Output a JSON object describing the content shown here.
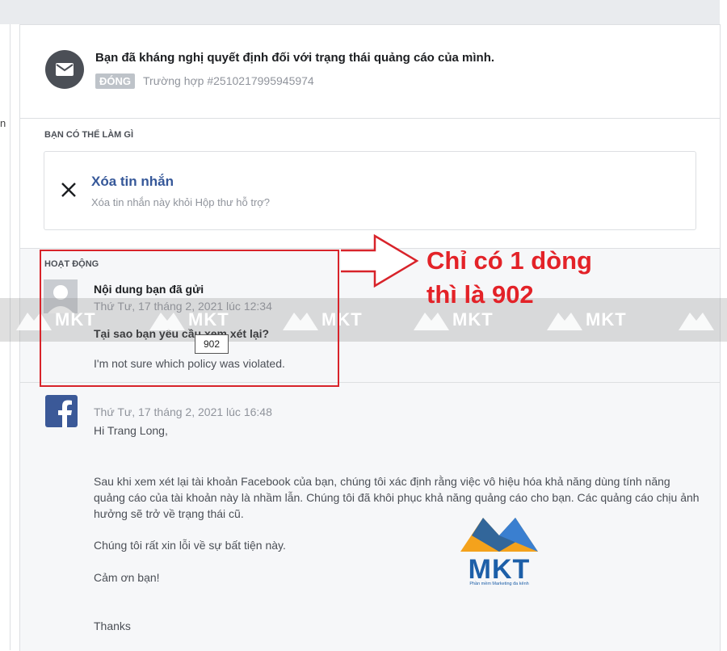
{
  "left_cut_text": "n",
  "header": {
    "title": "Bạn đã kháng nghị quyết định đối với trạng thái quảng cáo của mình.",
    "status_badge": "ĐÓNG",
    "case_text": "Trường hợp #2510217995945974"
  },
  "actions_section": {
    "label": "BẠN CÓ THỂ LÀM GÌ",
    "delete_title": "Xóa tin nhắn",
    "delete_desc": "Xóa tin nhắn này khỏi Hộp thư hỗ trợ?"
  },
  "activity": {
    "label": "HOẠT ĐỘNG",
    "message1": {
      "name": "Nội dung bạn đã gửi",
      "time": "Thứ Tư, 17 tháng 2, 2021 lúc 12:34",
      "question": "Tại sao bạn yêu cầu xem xét lại?",
      "answer": "I'm not sure which policy was violated."
    },
    "message2": {
      "time": "Thứ Tư, 17 tháng 2, 2021 lúc 16:48",
      "greeting": "Hi Trang Long,",
      "paragraph1": "Sau khi xem xét lại tài khoản Facebook của bạn, chúng tôi xác định rằng việc vô hiệu hóa khả năng dùng tính năng quảng cáo của tài khoản này là nhầm lẫn. Chúng tôi đã khôi phục khả năng quảng cáo cho bạn. Các quảng cáo chịu ảnh hưởng sẽ trở về trạng thái cũ.",
      "paragraph2": "Chúng tôi rất xin lỗi về sự bất tiện này.",
      "paragraph3": "Cảm ơn bạn!",
      "paragraph4": "Thanks"
    }
  },
  "overlay": {
    "tooltip": "902",
    "annotation_line1": "Chỉ có 1 dòng",
    "annotation_line2": "thì là 902",
    "watermark_text": "MKT",
    "logo_text": "MKT",
    "logo_tagline": "Phần mềm Marketing đa kênh"
  },
  "colors": {
    "link_blue": "#365899",
    "facebook_blue": "#3b5998",
    "annotation_red": "#e32228",
    "badge_gray": "#bec3c9",
    "logo_orange": "#f4a21c",
    "logo_blue": "#1d5fa8"
  },
  "icons": {
    "header_avatar": "envelope-icon",
    "delete_action": "close-icon",
    "message1_avatar": "user-silhouette-icon",
    "message2_avatar": "facebook-logo-icon"
  }
}
